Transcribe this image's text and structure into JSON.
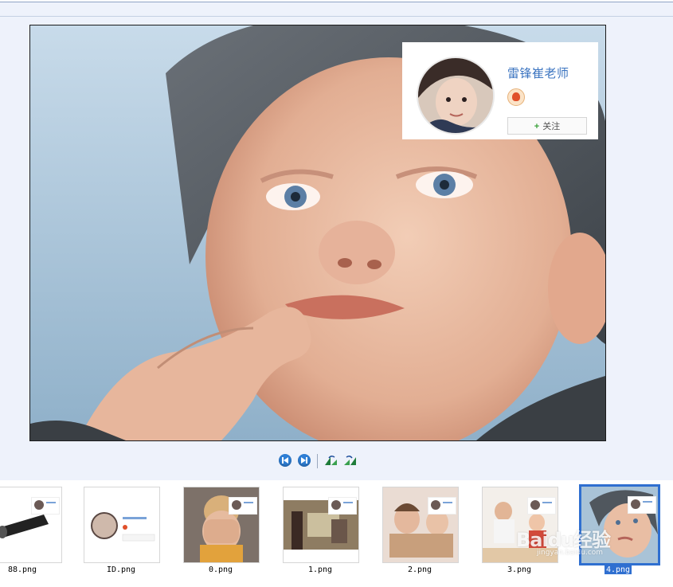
{
  "profile_card": {
    "name": "雷锋崔老师",
    "follow_label": "关注",
    "follow_plus": "+"
  },
  "controls": {
    "items": [
      {
        "name": "previous-icon"
      },
      {
        "name": "next-icon"
      },
      {
        "name": "rotate-left-icon"
      },
      {
        "name": "rotate-right-icon"
      }
    ]
  },
  "thumbnails": [
    {
      "label": "88.png",
      "selected": false
    },
    {
      "label": "ID.png",
      "selected": false
    },
    {
      "label": "0.png",
      "selected": false
    },
    {
      "label": "1.png",
      "selected": false
    },
    {
      "label": "2.png",
      "selected": false
    },
    {
      "label": "3.png",
      "selected": false
    },
    {
      "label": "4.png",
      "selected": true
    }
  ],
  "thumb_card_name": "雷锋崔老师",
  "thumb_card_follow": "+ 关注",
  "watermark": {
    "brand": "Baidu经验",
    "url": "jingyan.baidu.com"
  },
  "colors": {
    "accent": "#2f6fd0",
    "name": "#3b74c0",
    "background": "#eef2fb"
  }
}
